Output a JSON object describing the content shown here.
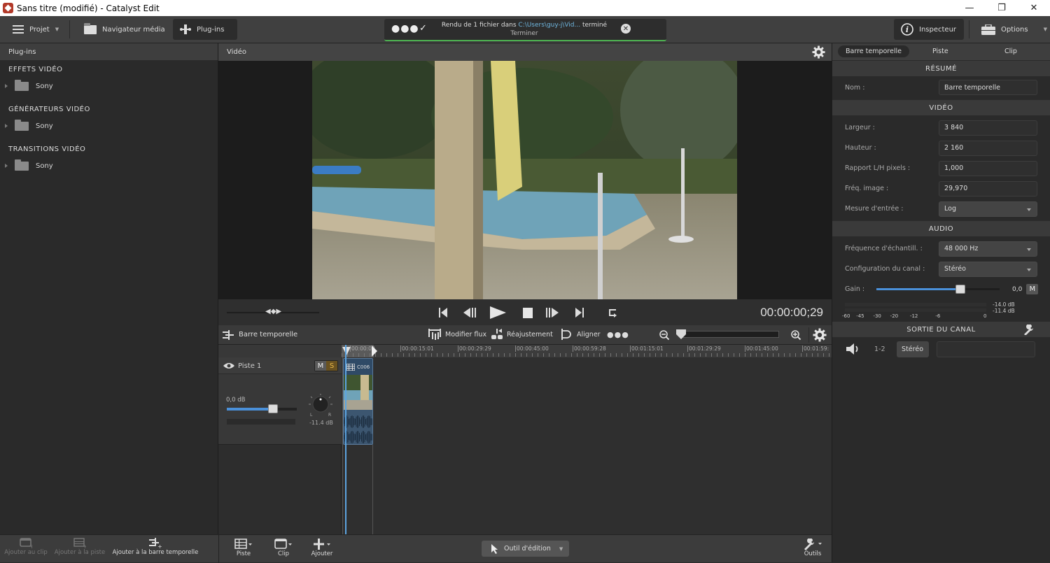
{
  "window": {
    "title": "Sans titre (modifié) - Catalyst Edit"
  },
  "toolbar": {
    "projet": "Projet",
    "media_browser": "Navigateur média",
    "plugins": "Plug-ins",
    "inspector": "Inspecteur",
    "options": "Options"
  },
  "notification": {
    "prefix": "Rendu de 1 fichier dans ",
    "path": "C:\\Users\\guy-j\\Vid...",
    "suffix": " terminé",
    "status": "Terminer"
  },
  "left_panel": {
    "title": "Plug-ins",
    "categories": [
      {
        "label": "EFFETS VIDÉO",
        "folder": "Sony"
      },
      {
        "label": "GÉNÉRATEURS VIDÉO",
        "folder": "Sony"
      },
      {
        "label": "TRANSITIONS VIDÉO",
        "folder": "Sony"
      }
    ]
  },
  "video_panel": {
    "title": "Vidéo",
    "timecode": "00:00:00;29"
  },
  "timeline": {
    "title": "Barre temporelle",
    "modify_flow": "Modifier flux",
    "readjust": "Réajustement",
    "align": "Aligner",
    "ruler_ticks": [
      "00:00:00",
      "00:00:15:01",
      "00:00:29:29",
      "00:00:45:00",
      "00:00:59:28",
      "00:01:15:01",
      "00:01:29:29",
      "00:01:45:00",
      "00:01:59:"
    ],
    "track": {
      "name": "Piste 1",
      "mute": "M",
      "solo": "S",
      "volume": "0,0 dB",
      "volume_fraction": 0.66,
      "pan_level": "-11.4 dB",
      "pan_left": "L",
      "pan_right": "R"
    },
    "clip": {
      "name": "C006"
    }
  },
  "bottom_bar": {
    "add_to_clip": "Ajouter au clip",
    "add_to_track": "Ajouter à la piste",
    "add_to_timeline": "Ajouter à la barre temporelle",
    "track": "Piste",
    "clip": "Clip",
    "add": "Ajouter",
    "edit_tool": "Outil d'édition",
    "tools": "Outils"
  },
  "inspector": {
    "tabs": [
      "Barre temporelle",
      "Piste",
      "Clip"
    ],
    "active_tab": "Barre temporelle",
    "summary": {
      "header": "RÉSUMÉ",
      "name_label": "Nom :",
      "name_value": "Barre temporelle"
    },
    "video": {
      "header": "VIDÉO",
      "rows": [
        {
          "label": "Largeur :",
          "value": "3 840"
        },
        {
          "label": "Hauteur :",
          "value": "2 160"
        },
        {
          "label": "Rapport L/H pixels :",
          "value": "1,000"
        },
        {
          "label": "Fréq. image :",
          "value": "29,970"
        }
      ],
      "input_measure_label": "Mesure d'entrée :",
      "input_measure_value": "Log"
    },
    "audio": {
      "header": "AUDIO",
      "sample_rate_label": "Fréquence d'échantill. :",
      "sample_rate_value": "48 000 Hz",
      "channel_config_label": "Configuration du canal :",
      "channel_config_value": "Stéréo",
      "gain_label": "Gain :",
      "gain_value": "0,0",
      "gain_fraction": 0.68,
      "mute": "M",
      "meter_scale": [
        "-60",
        "-45",
        "-30",
        "-20",
        "-12",
        "-6",
        "0"
      ],
      "meter_l": "-14.0 dB",
      "meter_r": "-11.4 dB"
    },
    "channel_output": {
      "header": "SORTIE DU CANAL",
      "channels": "1-2",
      "mode": "Stéréo"
    }
  }
}
